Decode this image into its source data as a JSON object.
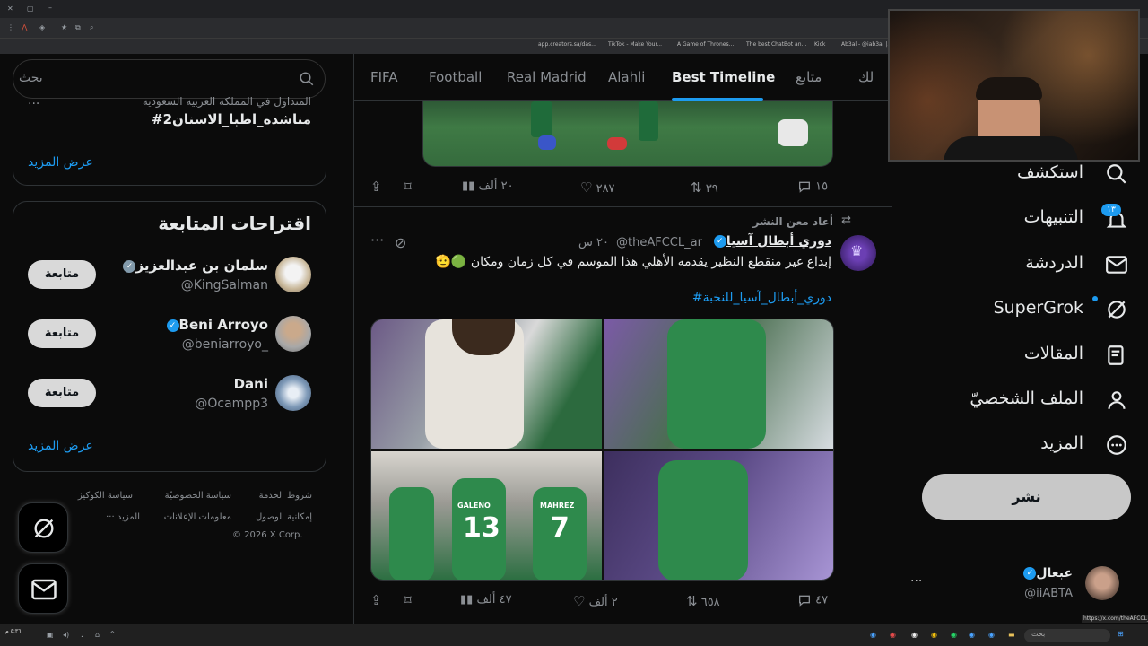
{
  "browser": {
    "bookmarks": [
      "app.creators.sa/das...",
      "TikTok - Make Your...",
      "A Game of Thrones...",
      "The best ChatBot an...",
      "Kick",
      "Ab3al - @iab3al |..."
    ]
  },
  "search": {
    "placeholder": "بحث"
  },
  "trend": {
    "context": "المتداول في المملكة العربية السعودية",
    "hashtag": "#مناشده_اطبا_الاسنان2",
    "show_more": "عرض المزيد"
  },
  "suggestions": {
    "title": "اقتراحات المتابعة",
    "follow_label": "متابعة",
    "show_more": "عرض المزيد",
    "users": [
      {
        "name": "سلمان بن عبدالعزيز",
        "handle": "@KingSalman",
        "badge": "gray"
      },
      {
        "name": "Beni Arroyo",
        "handle": "@beniarroyo_",
        "badge": "blue"
      },
      {
        "name": "Dani",
        "handle": "@Ocampp3",
        "badge": "none"
      }
    ]
  },
  "footer": {
    "links_row1": [
      "شروط الخدمة",
      "سياسة الخصوصيّة",
      "سياسة الكوكيز"
    ],
    "links_row2": [
      "إمكانية الوصول",
      "معلومات الإعلانات",
      "··· المزيد"
    ],
    "copyright": "© 2026 X Corp."
  },
  "tabs": [
    "لك",
    "متابع",
    "Best Timeline",
    "Alahli",
    "Real Madrid",
    "Football",
    "FIFA"
  ],
  "active_tab": "Best Timeline",
  "post1": {
    "actions": {
      "replies": "١٥",
      "reposts": "٣٩",
      "likes": "٢٨٧",
      "views": "٢٠ ألف"
    }
  },
  "post2": {
    "repost_note": "أعاد معن النشر",
    "author": "دوري أبطال آسيا",
    "handle": "@theAFCCL_ar",
    "time": "٢٠ س",
    "text": "إبداع غير منقطع النظير يقدمه الأهلي هذا الموسم في كل زمان ومكان 🟢🫡",
    "hashtag": "#دوري_أبطال_آسيا_للنخبة",
    "jersey_numbers": [
      "13",
      "7"
    ],
    "jersey_names": [
      "GALENO",
      "MAHREZ"
    ],
    "actions": {
      "replies": "٤٧",
      "reposts": "٦٥٨",
      "likes": "٢ ألف",
      "views": "٤٧ ألف"
    }
  },
  "nav": {
    "items": [
      "استكشف",
      "التنبيهات",
      "الدردشة",
      "SuperGrok",
      "المقالات",
      "الملف الشخصيّ",
      "المزيد"
    ],
    "notif_count": "١٣",
    "post_label": "نشر"
  },
  "account": {
    "name": "عبعال",
    "handle": "@iiABTA"
  },
  "status_url": "https://x.com/theAFCCL_ar",
  "taskbar": {
    "clock": "٤:٣٦ م",
    "search_placeholder": "بحث"
  },
  "colors": {
    "accent": "#1d9bf0",
    "background": "#0b0b0b",
    "border": "#2f3336",
    "muted": "#8b8f94"
  }
}
